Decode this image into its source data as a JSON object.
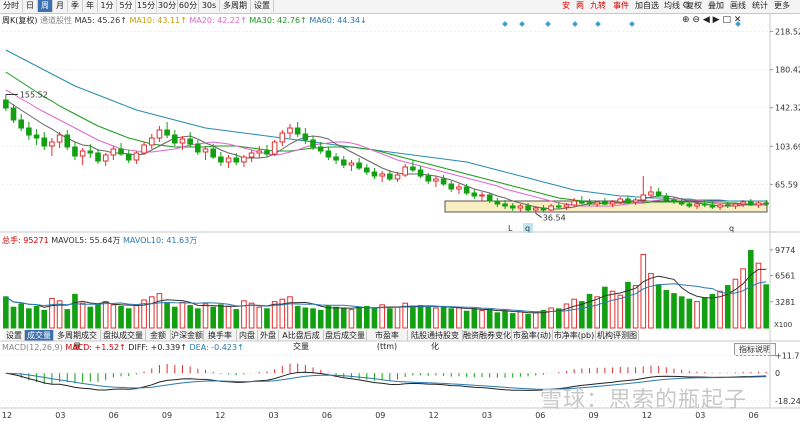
{
  "toolbar": {
    "period_tabs": [
      {
        "label": "分时",
        "active": false
      },
      {
        "label": "日",
        "active": false
      },
      {
        "label": "周",
        "active": true
      },
      {
        "label": "月",
        "active": false
      },
      {
        "label": "季",
        "active": false
      },
      {
        "label": "年",
        "active": false
      },
      {
        "label": "1分",
        "active": false
      },
      {
        "label": "5分",
        "active": false
      },
      {
        "label": "15分",
        "active": false
      },
      {
        "label": "30分",
        "active": false
      },
      {
        "label": "60分",
        "active": false
      },
      {
        "label": "30s",
        "active": false
      },
      {
        "label": "多周期",
        "active": false
      },
      {
        "label": "设置",
        "active": false
      }
    ],
    "right_tabs": [
      {
        "label": "安",
        "red": true
      },
      {
        "label": "两",
        "red": true
      },
      {
        "label": "九转",
        "red": true
      },
      {
        "label": "事件",
        "red": true
      },
      {
        "label": "加自选",
        "red": false
      },
      {
        "label": "均线",
        "red": false
      },
      {
        "label": "复权",
        "red": false
      },
      {
        "label": "叠加",
        "red": false
      },
      {
        "label": "画线",
        "red": false
      },
      {
        "label": "统计",
        "red": false
      },
      {
        "label": "更多",
        "red": false
      }
    ]
  },
  "main_legend": {
    "name": "周K(复权)",
    "sub": "通道股性",
    "ma5": "MA5: 45.26↑",
    "ma10": "MA10: 43.11↑",
    "ma20": "MA20: 42.22↑",
    "ma30": "MA30: 42.76↑",
    "ma60": "MA60: 44.34↓"
  },
  "vol_legend": {
    "total": "总手: 95271",
    "mavol5": "MAVOL5: 55.64万",
    "mavol10": "MAVOL10: 41.63万"
  },
  "macd_legend": {
    "params": "MACD(12,26,9)",
    "macd": "MACD: +1.52↑",
    "diff": "DIFF: +0.339↑",
    "dea": "DEA: -0.423↑"
  },
  "indicator_tabs": [
    {
      "label": "设置",
      "active": false
    },
    {
      "label": "成交量",
      "active": true
    },
    {
      "label": "多周期成交量",
      "active": false
    },
    {
      "label": "盘拟成交量",
      "active": false
    },
    {
      "label": "金额",
      "active": false
    },
    {
      "label": "沪深金额",
      "active": false
    },
    {
      "label": "换手率",
      "active": false
    },
    {
      "label": "内盘",
      "active": false
    },
    {
      "label": "外盘",
      "active": false
    },
    {
      "label": "A比盘后成交量",
      "active": false
    },
    {
      "label": "盘后成交量",
      "active": false
    },
    {
      "label": "市盈率(ttm)",
      "active": false
    },
    {
      "label": "陆股通持股变化",
      "active": false
    },
    {
      "label": "融资融券变化",
      "active": false
    },
    {
      "label": "市盈率(动)",
      "active": false
    },
    {
      "label": "市净率(pb)",
      "active": false
    },
    {
      "label": "机构评测图",
      "active": false
    }
  ],
  "buttons": {
    "help": "指标说明"
  },
  "watermark": "雪球：思索的瓶起子",
  "chart_data": {
    "type": "candlestick",
    "price_axis_labels": [
      "218.52",
      "180.42",
      "142.32",
      "103.69",
      "65.59"
    ],
    "price_axis_values": [
      218.52,
      180.42,
      142.32,
      103.69,
      65.59
    ],
    "ylim": [
      28,
      228
    ],
    "volume_axis_labels": [
      "9774",
      "6561",
      "3281",
      "X100"
    ],
    "volume_axis_values": [
      9774,
      6561,
      3281
    ],
    "volume_ylim": [
      0,
      10500
    ],
    "macd_axis_labels": [
      "+11.75",
      "0",
      "-18.24"
    ],
    "macd_axis_values": [
      11.75,
      0,
      -18.24
    ],
    "macd_ylim": [
      -21,
      14
    ],
    "x_labels": [
      "12",
      "03",
      "06",
      "09",
      "12",
      "03",
      "06",
      "09",
      "12",
      "03",
      "06",
      "09",
      "12",
      "03",
      "06"
    ],
    "annotations": {
      "high": "155.52",
      "low": "36.54",
      "mark_l": "L",
      "mark_q1": "q",
      "mark_q2": "q"
    },
    "candles": [
      [
        150,
        155.5,
        139,
        142
      ],
      [
        142,
        146,
        127,
        130
      ],
      [
        130,
        136,
        119,
        122
      ],
      [
        122,
        128,
        110,
        115
      ],
      [
        115,
        121,
        105,
        112
      ],
      [
        112,
        118,
        100,
        104
      ],
      [
        104,
        112,
        94,
        108
      ],
      [
        108,
        118,
        102,
        115
      ],
      [
        115,
        120,
        100,
        103
      ],
      [
        103,
        108,
        90,
        94
      ],
      [
        94,
        102,
        85,
        99
      ],
      [
        99,
        106,
        92,
        97
      ],
      [
        97,
        101,
        86,
        89
      ],
      [
        89,
        97,
        84,
        95
      ],
      [
        95,
        104,
        90,
        101
      ],
      [
        101,
        107,
        94,
        96
      ],
      [
        96,
        100,
        87,
        90
      ],
      [
        90,
        99,
        86,
        97
      ],
      [
        97,
        108,
        95,
        105
      ],
      [
        105,
        116,
        101,
        112
      ],
      [
        112,
        124,
        108,
        120
      ],
      [
        120,
        128,
        112,
        115
      ],
      [
        115,
        120,
        104,
        107
      ],
      [
        107,
        114,
        100,
        111
      ],
      [
        111,
        118,
        103,
        106
      ],
      [
        106,
        110,
        95,
        98
      ],
      [
        98,
        104,
        90,
        101
      ],
      [
        101,
        106,
        91,
        93
      ],
      [
        93,
        98,
        84,
        88
      ],
      [
        88,
        95,
        82,
        92
      ],
      [
        92,
        97,
        85,
        88
      ],
      [
        88,
        95,
        83,
        93
      ],
      [
        93,
        100,
        88,
        97
      ],
      [
        97,
        104,
        92,
        99
      ],
      [
        99,
        105,
        93,
        96
      ],
      [
        96,
        110,
        94,
        108
      ],
      [
        108,
        120,
        104,
        117
      ],
      [
        117,
        126,
        112,
        122
      ],
      [
        122,
        128,
        113,
        116
      ],
      [
        116,
        122,
        106,
        110
      ],
      [
        110,
        114,
        100,
        103
      ],
      [
        103,
        108,
        96,
        99
      ],
      [
        99,
        103,
        90,
        93
      ],
      [
        93,
        97,
        86,
        90
      ],
      [
        90,
        94,
        82,
        85
      ],
      [
        85,
        90,
        79,
        87
      ],
      [
        87,
        92,
        80,
        82
      ],
      [
        82,
        86,
        75,
        78
      ],
      [
        78,
        82,
        71,
        74
      ],
      [
        74,
        79,
        68,
        76
      ],
      [
        76,
        80,
        69,
        71
      ],
      [
        71,
        78,
        68,
        75
      ],
      [
        75,
        86,
        73,
        83
      ],
      [
        83,
        90,
        78,
        80
      ],
      [
        80,
        84,
        72,
        74
      ],
      [
        74,
        77,
        66,
        69
      ],
      [
        69,
        74,
        63,
        71
      ],
      [
        71,
        75,
        64,
        66
      ],
      [
        66,
        69,
        58,
        61
      ],
      [
        61,
        66,
        56,
        63
      ],
      [
        63,
        66,
        55,
        57
      ],
      [
        57,
        61,
        51,
        54
      ],
      [
        54,
        58,
        49,
        55
      ],
      [
        55,
        57,
        47,
        49
      ],
      [
        49,
        52,
        43,
        46
      ],
      [
        46,
        50,
        41,
        44
      ],
      [
        44,
        47,
        39,
        42
      ],
      [
        42,
        46,
        38,
        44
      ],
      [
        44,
        47,
        38,
        40
      ],
      [
        40,
        44,
        36.5,
        42
      ],
      [
        42,
        45,
        38,
        40
      ],
      [
        40,
        46,
        39,
        44
      ],
      [
        44,
        48,
        41,
        43
      ],
      [
        43,
        47,
        40,
        45
      ],
      [
        45,
        52,
        43,
        49
      ],
      [
        49,
        54,
        46,
        47
      ],
      [
        47,
        51,
        44,
        46
      ],
      [
        46,
        49,
        43,
        48
      ],
      [
        48,
        52,
        45,
        46
      ],
      [
        46,
        50,
        43,
        48
      ],
      [
        48,
        53,
        46,
        51
      ],
      [
        51,
        54,
        47,
        48
      ],
      [
        48,
        52,
        45,
        50
      ],
      [
        50,
        74,
        48,
        55
      ],
      [
        55,
        64,
        52,
        58
      ],
      [
        58,
        62,
        53,
        54
      ],
      [
        54,
        57,
        48,
        50
      ],
      [
        50,
        53,
        46,
        48
      ],
      [
        48,
        52,
        44,
        46
      ],
      [
        46,
        49,
        42,
        44
      ],
      [
        44,
        48,
        41,
        46
      ],
      [
        46,
        50,
        43,
        45
      ],
      [
        45,
        48,
        41,
        43
      ],
      [
        43,
        47,
        40,
        45
      ],
      [
        45,
        48,
        42,
        44
      ],
      [
        44,
        47,
        41,
        46
      ],
      [
        46,
        50,
        43,
        48
      ],
      [
        48,
        51,
        44,
        45
      ],
      [
        45,
        49,
        42,
        47
      ],
      [
        47,
        50,
        44,
        46
      ]
    ],
    "volumes": [
      3900,
      2600,
      3000,
      2400,
      2700,
      2200,
      3700,
      3400,
      2300,
      4200,
      3100,
      2600,
      3000,
      3300,
      2900,
      2700,
      2400,
      2800,
      3500,
      3900,
      4300,
      3100,
      2600,
      3200,
      2800,
      2400,
      3000,
      2600,
      2900,
      2700,
      2300,
      3400,
      3100,
      2600,
      2400,
      3300,
      3600,
      3900,
      2700,
      2500,
      2400,
      2200,
      2800,
      2600,
      2500,
      2300,
      2600,
      2700,
      2500,
      2900,
      2400,
      2600,
      3100,
      2700,
      2800,
      2600,
      2500,
      2700,
      2400,
      2500,
      2100,
      2400,
      2200,
      2300,
      1900,
      2100,
      1800,
      2000,
      1700,
      1900,
      2200,
      2500,
      2400,
      3000,
      3600,
      3300,
      4200,
      3900,
      5100,
      4600,
      4100,
      5700,
      5300,
      9200,
      6800,
      5400,
      4700,
      4300,
      3900,
      3600,
      3300,
      3800,
      4200,
      4600,
      5300,
      6100,
      7400,
      9700,
      8100,
      5400
    ],
    "ma5": [
      150,
      145,
      140,
      135,
      130,
      125,
      121,
      116,
      112,
      108,
      105,
      104,
      100,
      99,
      97,
      97,
      96,
      95,
      96,
      100,
      104,
      108,
      112,
      113,
      114,
      111,
      107,
      104,
      100,
      97,
      95,
      92,
      92,
      92,
      93,
      96,
      101,
      106,
      110,
      113,
      114,
      113,
      111,
      106,
      102,
      98,
      94,
      90,
      86,
      82,
      79,
      77,
      76,
      76,
      76,
      75,
      74,
      72,
      70,
      67,
      64,
      61,
      59,
      57,
      54,
      52,
      49,
      47,
      45,
      43,
      42,
      41,
      41,
      42,
      43,
      45,
      46,
      46,
      47,
      47,
      48,
      48,
      49,
      51,
      53,
      54,
      54,
      53,
      51,
      49,
      47,
      46,
      45,
      44,
      44,
      44,
      45,
      46,
      46,
      46
    ],
    "ma10": [
      160,
      156,
      151,
      147,
      142,
      138,
      134,
      130,
      126,
      122,
      118,
      114,
      110,
      107,
      104,
      101,
      100,
      99,
      98,
      98,
      99,
      100,
      101,
      103,
      105,
      106,
      107,
      108,
      107,
      106,
      104,
      102,
      100,
      98,
      96,
      95,
      96,
      98,
      100,
      103,
      105,
      106,
      107,
      108,
      108,
      107,
      105,
      102,
      99,
      96,
      93,
      90,
      88,
      86,
      84,
      82,
      80,
      78,
      76,
      74,
      72,
      70,
      68,
      66,
      64,
      61,
      59,
      57,
      55,
      53,
      51,
      49,
      47,
      46,
      45,
      44,
      44,
      44,
      44,
      44,
      45,
      46,
      47,
      48,
      49,
      50,
      51,
      51,
      51,
      50,
      50,
      49,
      48,
      47,
      46,
      46,
      45,
      45,
      45,
      45
    ],
    "ma20": [
      178,
      173,
      168,
      163,
      158,
      153,
      149,
      144,
      140,
      136,
      132,
      128,
      124,
      121,
      118,
      115,
      112,
      110,
      108,
      106,
      105,
      104,
      103,
      103,
      103,
      103,
      103,
      104,
      104,
      104,
      104,
      103,
      102,
      101,
      100,
      99,
      99,
      99,
      100,
      101,
      102,
      102,
      103,
      103,
      103,
      103,
      102,
      101,
      100,
      98,
      96,
      94,
      92,
      90,
      88,
      86,
      84,
      82,
      80,
      78,
      76,
      74,
      72,
      70,
      68,
      66,
      64,
      62,
      60,
      58,
      56,
      54,
      52,
      51,
      50,
      49,
      48,
      47,
      47,
      47,
      47,
      47,
      47,
      47,
      48,
      48,
      48,
      48,
      48,
      48,
      48,
      48,
      47,
      47,
      47,
      47,
      46,
      46,
      46,
      46
    ],
    "ma60": [
      200,
      196,
      192,
      188,
      184,
      180,
      176,
      172,
      168,
      164,
      161,
      158,
      155,
      152,
      149,
      146,
      143,
      140,
      138,
      136,
      134,
      132,
      130,
      128,
      126,
      124,
      122,
      121,
      120,
      119,
      118,
      117,
      116,
      115,
      114,
      113,
      112,
      111,
      110,
      109,
      108,
      107,
      106,
      105,
      104,
      103,
      102,
      101,
      100,
      99,
      98,
      97,
      96,
      95,
      94,
      93,
      92,
      91,
      90,
      89,
      88,
      86,
      84,
      82,
      80,
      78,
      76,
      74,
      72,
      70,
      68,
      66,
      64,
      62,
      60,
      59,
      58,
      57,
      56,
      55,
      54,
      54,
      53,
      53,
      52,
      52,
      52,
      51,
      51,
      51,
      50,
      50,
      50,
      50,
      49,
      49,
      49,
      49,
      49,
      49
    ]
  }
}
